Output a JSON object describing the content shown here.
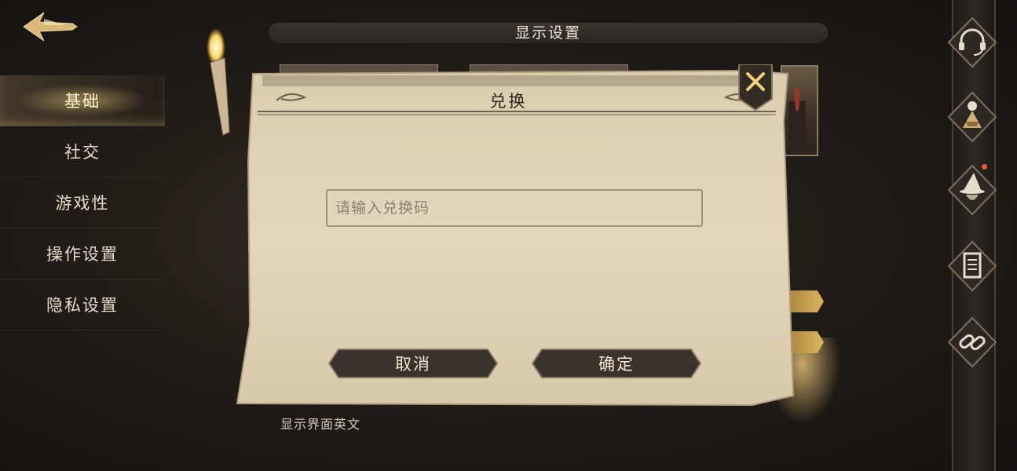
{
  "header": {
    "title": "显示设置",
    "back_icon": "back-arrow-icon"
  },
  "sidebar": {
    "items": [
      {
        "label": "基础",
        "active": true
      },
      {
        "label": "社交",
        "active": false
      },
      {
        "label": "游戏性",
        "active": false
      },
      {
        "label": "操作设置",
        "active": false
      },
      {
        "label": "隐私设置",
        "active": false
      }
    ]
  },
  "footer": {
    "text": "显示界面英文"
  },
  "dialog": {
    "title": "兑换",
    "input_placeholder": "请输入兑换码",
    "cancel_label": "取消",
    "confirm_label": "确定",
    "close_icon": "close-icon"
  },
  "right_rail": {
    "icons": [
      "headset-icon",
      "character-icon",
      "wizard-hat-icon",
      "scroll-icon",
      "link-icon"
    ],
    "badge_color": "#e0602e"
  },
  "colors": {
    "parchment": "#e0d3b8",
    "dark_bg": "#231d18",
    "accent_gold": "#d9b45e"
  }
}
